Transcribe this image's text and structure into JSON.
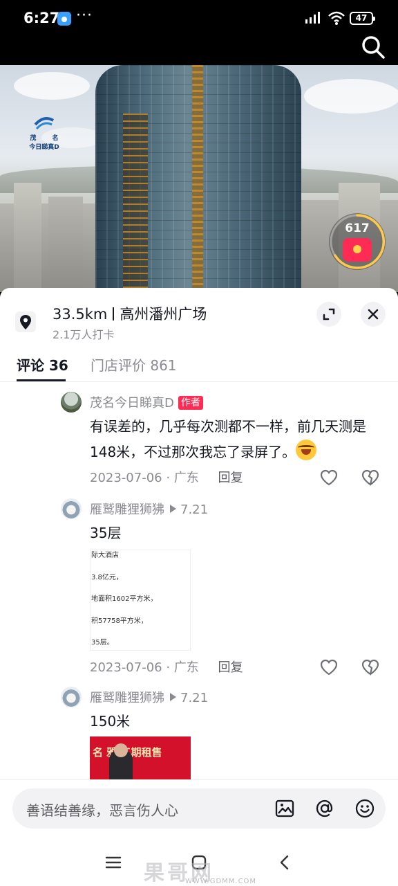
{
  "status": {
    "time": "6:27",
    "dots": "···",
    "battery": "47"
  },
  "video": {
    "logo_line1": "茂 名",
    "logo_line2": "今日睇真D",
    "redpacket_count": "617"
  },
  "location": {
    "distance": "33.5km",
    "name": "高州潘州广场",
    "checkins": "2.1万人打卡"
  },
  "tabs": {
    "comments": "评论 36",
    "reviews": "门店评价 861"
  },
  "comments": [
    {
      "user": "茂名今日睇真D",
      "tag": "作者",
      "text": "有误差的，几乎每次测都不一样，前几天测是148米，不过那次我忘了录屏了。",
      "date": "2023-07-06 · 广东",
      "reply": "回复"
    },
    {
      "user": "雁鹫雕狸狮狒",
      "reply_to": "7.21",
      "text": "35层",
      "image_lines": [
        "际大酒店",
        "3.8亿元，",
        "地面积1602平方米，",
        "积57758平方米，",
        "35层。"
      ],
      "date": "2023-07-06 · 广东",
      "reply": "回复"
    },
    {
      "user": "雁鹫雕狸狮狒",
      "reply_to": "7.21",
      "text": "150米",
      "image_text": "名 雅 三期租售"
    }
  ],
  "input": {
    "placeholder": "善语结善缘，恶言伤人心"
  },
  "watermark": {
    "text": "果哥网",
    "url": "WWW.GDMM.COM"
  },
  "colors": {
    "accent": "#fe2c55",
    "text_primary": "#161823",
    "text_secondary": "#8a8b91"
  }
}
